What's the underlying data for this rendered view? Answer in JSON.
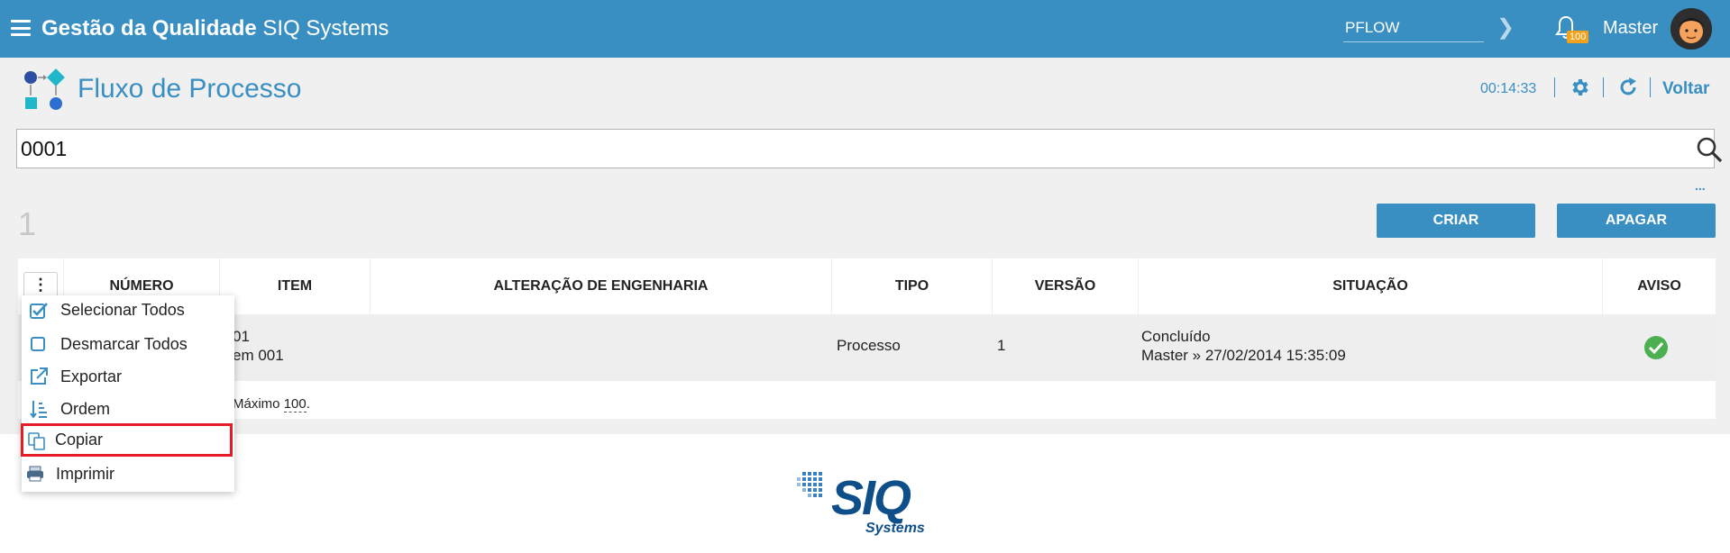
{
  "header": {
    "brand_bold": "Gestão da Qualidade",
    "brand_light": "SIQ Systems",
    "module_value": "PFLOW",
    "notification_count": "100",
    "user_name": "Master"
  },
  "page": {
    "title": "Fluxo de Processo",
    "timer": "00:14:33",
    "back_label": "Voltar"
  },
  "search": {
    "value": "0001",
    "more": "..."
  },
  "results": {
    "count": "1",
    "create_label": "CRIAR",
    "delete_label": "APAGAR"
  },
  "table": {
    "columns": [
      "NÚMERO",
      "ITEM",
      "ALTERAÇÃO DE ENGENHARIA",
      "TIPO",
      "VERSÃO",
      "SITUAÇÃO",
      "AVISO"
    ],
    "rows": [
      {
        "numero": "01",
        "item": "em 001",
        "alteracao": "",
        "tipo": "Processo",
        "versao": "1",
        "situacao": "Concluído",
        "situacao_detail": "Master » 27/02/2014 15:35:09",
        "aviso_icon": "check-circle-icon"
      }
    ],
    "footer_prefix": "Máximo",
    "footer_max": "100",
    "footer_suffix": "."
  },
  "menu": {
    "items": [
      {
        "label": "Selecionar Todos",
        "icon": "checkbox-checked-icon"
      },
      {
        "label": "Desmarcar Todos",
        "icon": "checkbox-empty-icon"
      },
      {
        "label": "Exportar",
        "icon": "external-link-icon"
      },
      {
        "label": "Ordem",
        "icon": "sort-icon"
      },
      {
        "label": "Copiar",
        "icon": "copy-icon"
      },
      {
        "label": "Imprimir",
        "icon": "printer-icon"
      }
    ]
  },
  "footer": {
    "logo_text": "SIQ",
    "logo_sub": "Systems"
  },
  "colors": {
    "primary": "#3a8fc2",
    "badge": "#f2a21b",
    "highlight": "#e51c23",
    "success": "#4caf50"
  }
}
